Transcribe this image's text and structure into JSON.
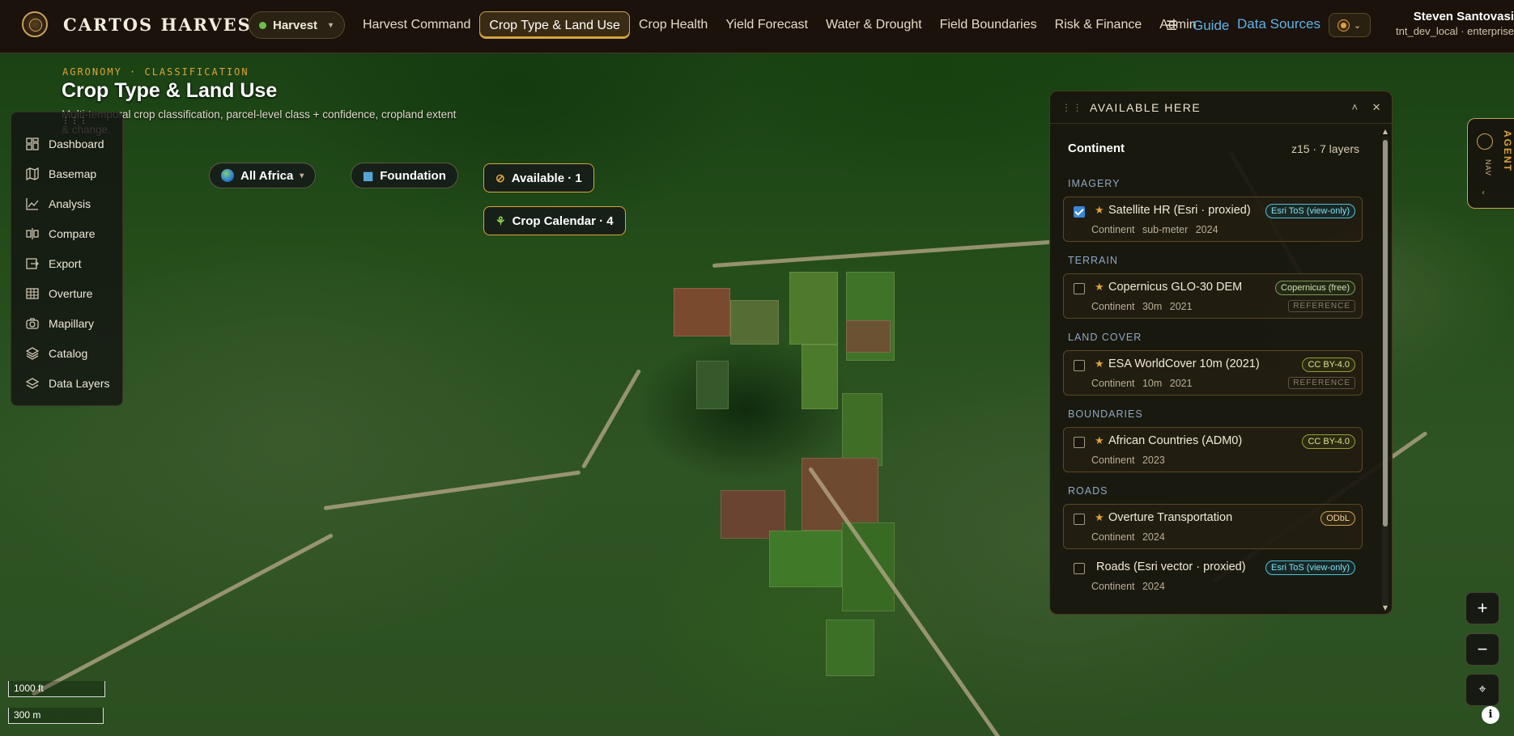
{
  "brand": {
    "name": "CARTOS HARVEST",
    "workspace": "Harvest"
  },
  "nav": {
    "items": [
      {
        "label": "Harvest Command"
      },
      {
        "label": "Crop Type & Land Use"
      },
      {
        "label": "Crop Health"
      },
      {
        "label": "Yield Forecast"
      },
      {
        "label": "Water & Drought"
      },
      {
        "label": "Field Boundaries"
      },
      {
        "label": "Risk & Finance"
      },
      {
        "label": "Admin"
      }
    ],
    "active": "Crop Type & Land Use",
    "guide": "Guide",
    "data_sources": "Data Sources"
  },
  "user": {
    "name": "Steven Santovasi",
    "org": "tnt_dev_local · enterprise"
  },
  "page": {
    "eyebrow": "AGRONOMY · CLASSIFICATION",
    "title": "Crop Type & Land Use",
    "subtitle_line1": "Multi-temporal crop classification, parcel-level class + confidence, cropland extent",
    "subtitle_line2": "& change."
  },
  "tools": [
    {
      "label": "Dashboard",
      "icon": "dashboard-icon"
    },
    {
      "label": "Basemap",
      "icon": "map-icon"
    },
    {
      "label": "Analysis",
      "icon": "chart-icon"
    },
    {
      "label": "Compare",
      "icon": "compare-icon"
    },
    {
      "label": "Export",
      "icon": "export-icon"
    },
    {
      "label": "Overture",
      "icon": "grid-icon"
    },
    {
      "label": "Mapillary",
      "icon": "camera-icon"
    },
    {
      "label": "Catalog",
      "icon": "layers-icon"
    },
    {
      "label": "Data Layers",
      "icon": "stack-icon"
    }
  ],
  "chips": {
    "region": "All Africa",
    "foundation": "Foundation",
    "available": "Available · 1",
    "crop_calendar": "Crop Calendar · 4"
  },
  "panel": {
    "title": "AVAILABLE HERE",
    "scope": "Continent",
    "zoom_info": "z15 · 7 layers",
    "sections": [
      {
        "name": "IMAGERY",
        "layers": [
          {
            "name": "Satellite HR (Esri · proxied)",
            "license": "Esri ToS (view-only)",
            "meta": "Continent  sub-meter  2024",
            "checked": true,
            "starred": true,
            "reference": ""
          }
        ]
      },
      {
        "name": "TERRAIN",
        "layers": [
          {
            "name": "Copernicus GLO-30 DEM",
            "license": "Copernicus (free)",
            "meta": "Continent  30m  2021",
            "checked": false,
            "starred": true,
            "reference": "REFERENCE"
          }
        ]
      },
      {
        "name": "LAND COVER",
        "layers": [
          {
            "name": "ESA WorldCover 10m (2021)",
            "license": "CC BY-4.0",
            "meta": "Continent  10m  2021",
            "checked": false,
            "starred": true,
            "reference": "REFERENCE"
          }
        ]
      },
      {
        "name": "BOUNDARIES",
        "layers": [
          {
            "name": "African Countries (ADM0)",
            "license": "CC BY-4.0",
            "meta": "Continent  2023",
            "checked": false,
            "starred": true,
            "reference": ""
          }
        ]
      },
      {
        "name": "ROADS",
        "layers": [
          {
            "name": "Overture Transportation",
            "license": "ODbL",
            "meta": "Continent  2024",
            "checked": false,
            "starred": true,
            "reference": ""
          },
          {
            "name": "Roads (Esri vector · proxied)",
            "license": "Esri ToS (view-only)",
            "meta": "Continent  2024",
            "checked": false,
            "starred": false,
            "reference": ""
          }
        ]
      }
    ]
  },
  "agent": {
    "nav_label": "NAV",
    "tab_label": "AGENT"
  },
  "map": {
    "scale_imperial": "1000 ft",
    "scale_metric": "300 m",
    "zoom_in": "+",
    "zoom_out": "−",
    "locate": "⌖",
    "info": "i"
  },
  "colors": {
    "accent": "#d9a43a",
    "link": "#5fb3e8",
    "status_dot": "#6cc04a",
    "checkbox": "#3b86d6"
  }
}
